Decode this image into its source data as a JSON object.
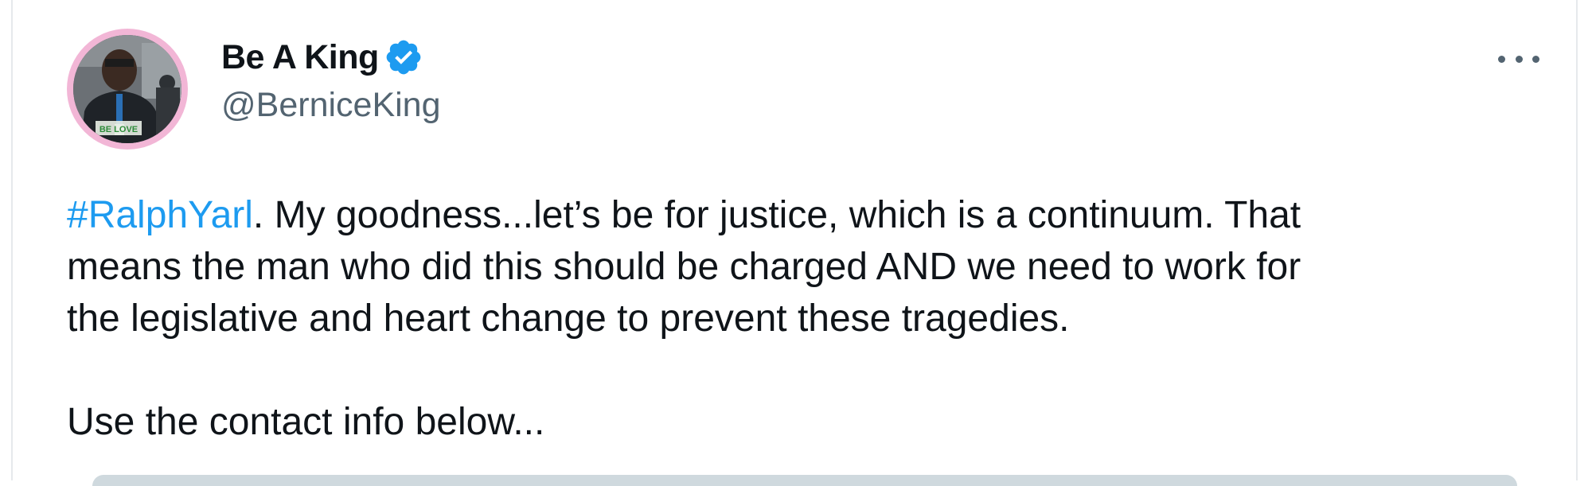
{
  "author": {
    "display_name": "Be A King",
    "handle": "@BerniceKing",
    "verified": true,
    "avatar_badge_text": "BE LOVE"
  },
  "menu": {
    "more_icon": "more-horizontal-icon"
  },
  "tweet": {
    "hashtag": "#RalphYarl",
    "line1_rest": ". My goodness...let’s be for justice, which is a continuum. That",
    "line2": "means the man who did this should be charged AND we need to work for",
    "line3": "the legislative and heart change to prevent these tragedies.",
    "line4": "Use the contact info below..."
  },
  "colors": {
    "accent": "#1d9bf0",
    "text": "#0f1419",
    "secondary": "#536471",
    "avatar_ring": "#f2b6d6"
  }
}
